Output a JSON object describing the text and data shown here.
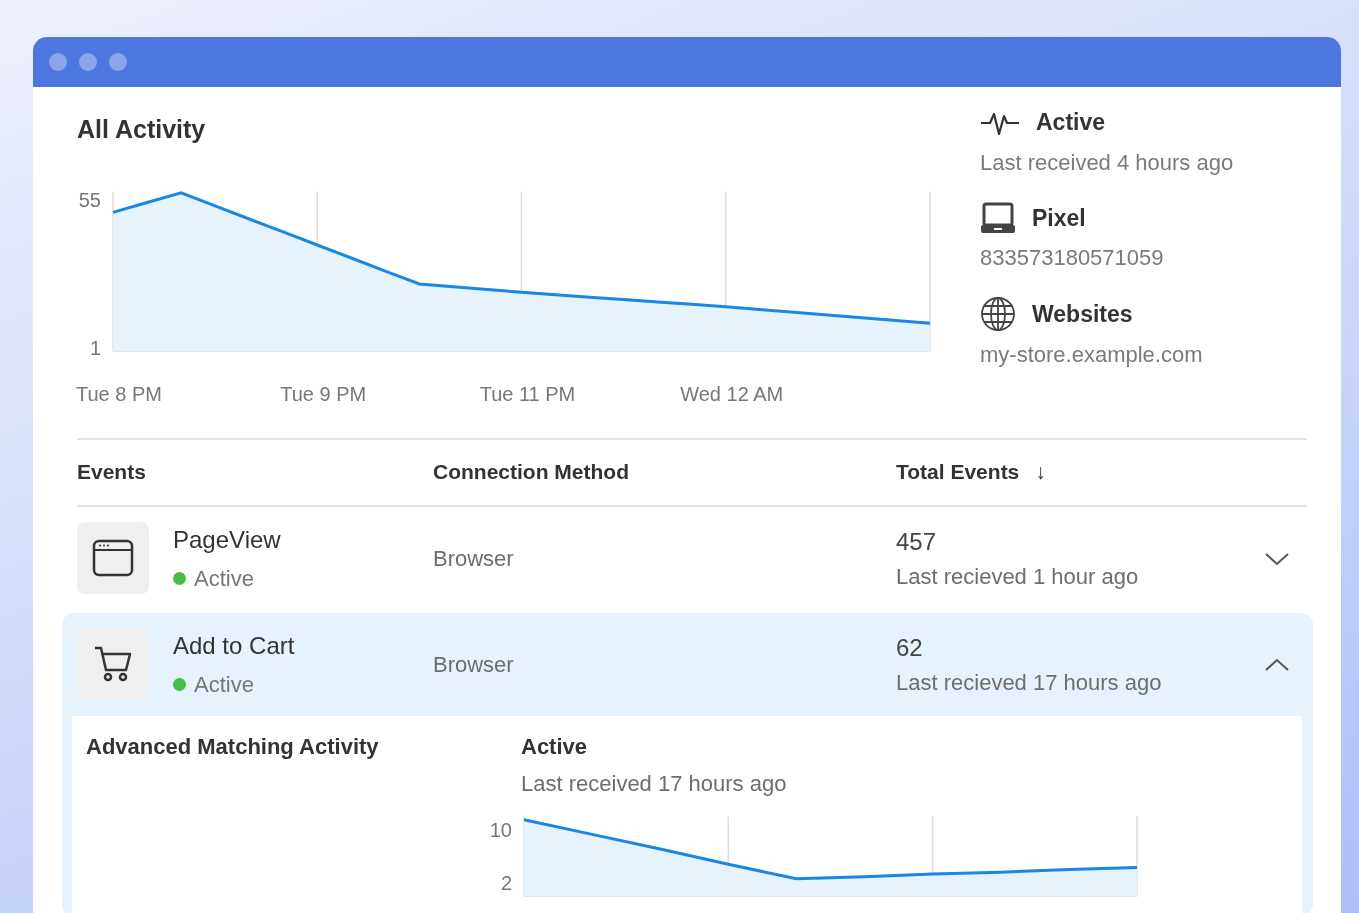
{
  "activity": {
    "title": "All Activity",
    "chart_data": {
      "type": "area",
      "categories": [
        "Tue 8 PM",
        null,
        null,
        null,
        null,
        null,
        "Tue 9 PM",
        null,
        null,
        null,
        null,
        null,
        "Tue 11 PM",
        null,
        null,
        null,
        null,
        null,
        "Wed 12 AM",
        null,
        null,
        null,
        null,
        null,
        null
      ],
      "series": [
        {
          "color": "#1a87e5",
          "values": [
            50.5,
            54.1,
            57.6,
            52.9,
            48.1,
            43.4,
            38.6,
            33.9,
            29.1,
            24.4,
            23.4,
            22.4,
            21.4,
            20.5,
            19.6,
            18.8,
            17.9,
            17.0,
            16.1,
            15.1,
            14.1,
            13.1,
            12.1,
            11.1,
            10.1
          ]
        }
      ],
      "ylim": [
        0,
        58
      ],
      "yticks": [
        55,
        1
      ],
      "grid": true
    }
  },
  "summary": [
    {
      "kind": "pulse",
      "title": "Active",
      "detail": "Last received 4 hours ago"
    },
    {
      "kind": "laptop",
      "title": "Pixel",
      "detail": "833573180571059"
    },
    {
      "kind": "globe",
      "title": "Websites",
      "detail": "my-store.example.com"
    }
  ],
  "table": {
    "columns": [
      {
        "label": "Events"
      },
      {
        "label": "Connection Method"
      },
      {
        "label": "Total Events",
        "sort_icon": "↓"
      }
    ],
    "rows": [
      {
        "kind": "browser",
        "name": "PageView",
        "active": true,
        "status": "Active",
        "method": "Browser",
        "total": "457",
        "last": "Last recieved 1 hour ago",
        "expanded": false
      },
      {
        "kind": "cart",
        "name": "Add to Cart",
        "active": true,
        "status": "Active",
        "method": "Browser",
        "total": "62",
        "last": "Last recieved 17 hours ago",
        "expanded": true,
        "detail": {
          "title": "Advanced Matching Activity",
          "status": "Active",
          "last": "Last received 17 hours ago",
          "chart_data": {
            "type": "area",
            "categories": [
              null,
              null,
              null,
              null,
              null,
              null,
              null,
              null,
              null,
              null
            ],
            "series": [
              {
                "color": "#1a87e5",
                "values": [
                  11.5,
                  9.3,
                  7.1,
                  4.8,
                  2.6,
                  2.9,
                  3.3,
                  3.6,
                  4.0,
                  4.3
                ]
              }
            ],
            "ylim": [
              0,
              12
            ],
            "yticks": [
              10,
              2
            ],
            "grid": true
          }
        }
      }
    ]
  }
}
